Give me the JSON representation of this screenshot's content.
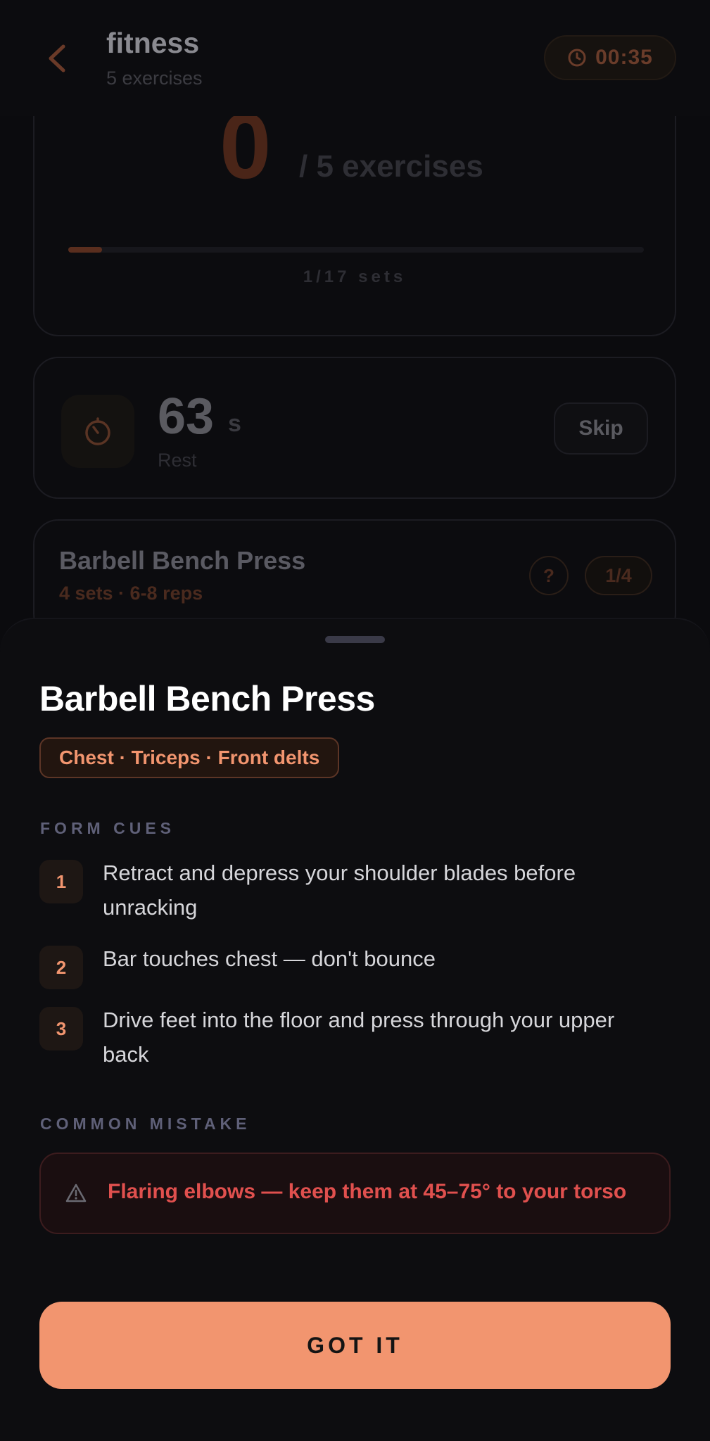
{
  "header": {
    "title": "fitness",
    "subtitle": "5 exercises",
    "timer": "00:35"
  },
  "progress": {
    "completed": "0",
    "total_label": "/ 5 exercises",
    "sets_label": "1/17 sets",
    "sets_fraction": 0.0588
  },
  "rest": {
    "seconds": "63",
    "unit": "s",
    "label": "Rest",
    "skip_label": "Skip"
  },
  "current_exercise": {
    "name": "Barbell Bench Press",
    "meta": "4 sets · 6-8 reps",
    "help_label": "?",
    "set_badge": "1/4"
  },
  "sheet": {
    "title": "Barbell Bench Press",
    "muscles": "Chest · Triceps · Front delts",
    "form_cues_label": "FORM CUES",
    "cues": [
      {
        "num": "1",
        "text": "Retract and depress your shoulder blades before unracking"
      },
      {
        "num": "2",
        "text": "Bar touches chest — don't bounce"
      },
      {
        "num": "3",
        "text": "Drive feet into the floor and press through your upper back"
      }
    ],
    "mistake_label": "COMMON MISTAKE",
    "mistake_text": "Flaring elbows — keep them at 45–75° to your torso",
    "button_label": "GOT IT"
  },
  "colors": {
    "accent": "#f2956f",
    "warning": "#e0504e",
    "background": "#0d0d10"
  },
  "icons": [
    "chevron-left-icon",
    "clock-icon",
    "stopwatch-icon",
    "warning-triangle-icon"
  ]
}
